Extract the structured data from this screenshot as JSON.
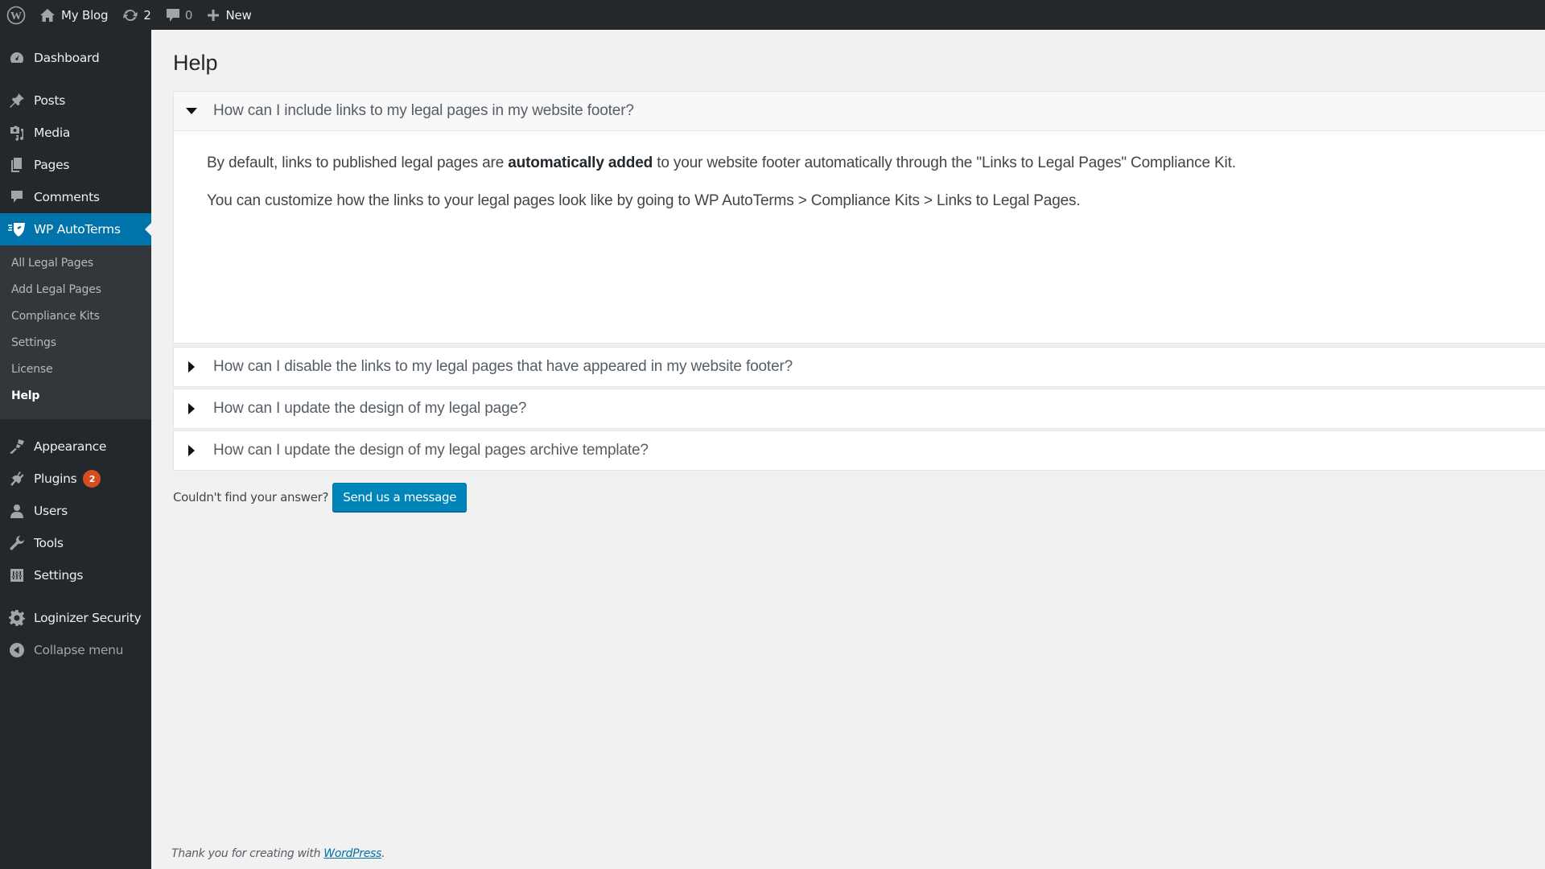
{
  "adminbar": {
    "site_name": "My Blog",
    "updates_count": "2",
    "comments_count": "0",
    "new_label": "New"
  },
  "sidebar": {
    "items": [
      {
        "label": "Dashboard",
        "icon": "dashboard-icon"
      },
      {
        "label": "Posts",
        "icon": "pin-icon"
      },
      {
        "label": "Media",
        "icon": "media-icon"
      },
      {
        "label": "Pages",
        "icon": "pages-icon"
      },
      {
        "label": "Comments",
        "icon": "comment-icon"
      },
      {
        "label": "WP AutoTerms",
        "icon": "autoterms-shield-icon",
        "active": true
      },
      {
        "label": "Appearance",
        "icon": "paintbrush-icon"
      },
      {
        "label": "Plugins",
        "icon": "plugin-icon",
        "badge": "2"
      },
      {
        "label": "Users",
        "icon": "user-icon"
      },
      {
        "label": "Tools",
        "icon": "wrench-icon"
      },
      {
        "label": "Settings",
        "icon": "settings-sliders-icon"
      },
      {
        "label": "Loginizer Security",
        "icon": "gear-icon"
      },
      {
        "label": "Collapse menu",
        "icon": "collapse-arrow-icon"
      }
    ],
    "submenu": [
      {
        "label": "All Legal Pages"
      },
      {
        "label": "Add Legal Pages"
      },
      {
        "label": "Compliance Kits"
      },
      {
        "label": "Settings"
      },
      {
        "label": "License"
      },
      {
        "label": "Help",
        "current": true
      }
    ]
  },
  "main": {
    "title": "Help",
    "faq": [
      {
        "question": "How can I include links to my legal pages in my website footer?",
        "expanded": true,
        "answer": {
          "p1_before": "By default, links to published legal pages are ",
          "p1_bold": "automatically added",
          "p1_after": " to your website footer automatically through the \"Links to Legal Pages\" Compliance Kit.",
          "p2": "You can customize how the links to your legal pages look like by going to WP AutoTerms > Compliance Kits > Links to Legal Pages."
        }
      },
      {
        "question": "How can I disable the links to my legal pages that have appeared in my website footer?",
        "expanded": false
      },
      {
        "question": "How can I update the design of my legal page?",
        "expanded": false
      },
      {
        "question": "How can I update the design of my legal pages archive template?",
        "expanded": false
      }
    ],
    "not_found_label": "Couldn't find your answer?",
    "send_button": "Send us a message"
  },
  "footer": {
    "text": "Thank you for creating with ",
    "link": "WordPress",
    "suffix": "."
  },
  "colors": {
    "adminbar_bg": "#23282d",
    "active_menu": "#0073aa",
    "button": "#0085ba",
    "badge": "#d54e21"
  }
}
